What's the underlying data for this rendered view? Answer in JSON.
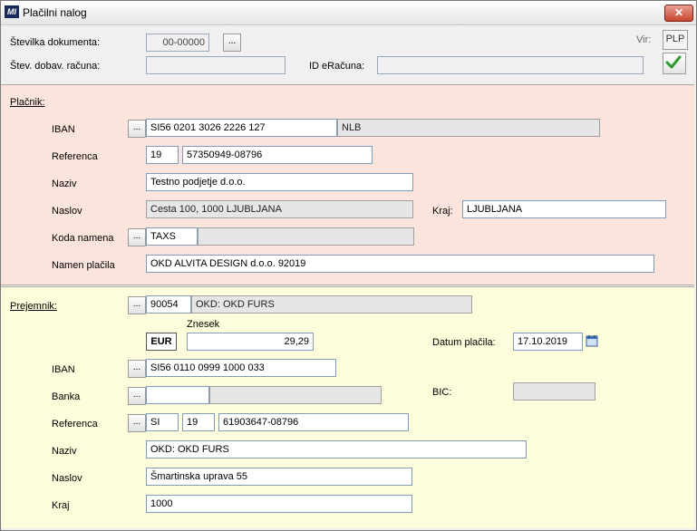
{
  "window": {
    "title": "Plačilni nalog",
    "close_label": "✕"
  },
  "header": {
    "doc_number_label": "Številka dokumenta:",
    "doc_number_value": "00-00000",
    "dots": "...",
    "supplier_invoice_label": "Štev. dobav. računa:",
    "supplier_invoice_value": "",
    "einvoice_label": "ID eRačuna:",
    "einvoice_value": "",
    "source_label": "Vir:",
    "source_value": "PLP"
  },
  "payer": {
    "section_label": "Plačnik:",
    "iban_label": "IBAN",
    "iban_value": "SI56 0201 3026 2226 127",
    "bank_value": "NLB",
    "reference_label": "Referenca",
    "reference_model": "19",
    "reference_value": "57350949-08796",
    "name_label": "Naziv",
    "name_value": "Testno podjetje d.o.o.",
    "address_label": "Naslov",
    "address_value": "Cesta 100, 1000 LJUBLJANA",
    "city_label": "Kraj:",
    "city_value": "LJUBLJANA",
    "purpose_code_label": "Koda namena",
    "purpose_code_value": "TAXS",
    "purpose_code_desc": "",
    "purpose_label": "Namen plačila",
    "purpose_value": "OKD ALVITA DESIGN d.o.o. 92019"
  },
  "payee": {
    "section_label": "Prejemnik:",
    "code_value": "90054",
    "code_name": "OKD: OKD FURS",
    "amount_label": "Znesek",
    "currency": "EUR",
    "amount_value": "29,29",
    "date_label": "Datum plačila:",
    "date_value": "17.10.2019",
    "iban_label": "IBAN",
    "iban_value": "SI56 0110 0999 1000 033",
    "bank_label": "Banka",
    "bank_value": "",
    "bank_name": "",
    "bic_label": "BIC:",
    "bic_value": "",
    "reference_label": "Referenca",
    "reference_country": "SI",
    "reference_model": "19",
    "reference_value": "61903647-08796",
    "name_label": "Naziv",
    "name_value": "OKD: OKD FURS",
    "address_label": "Naslov",
    "address_value": "Šmartinska uprava 55",
    "city_label": "Kraj",
    "city_value": "1000"
  }
}
